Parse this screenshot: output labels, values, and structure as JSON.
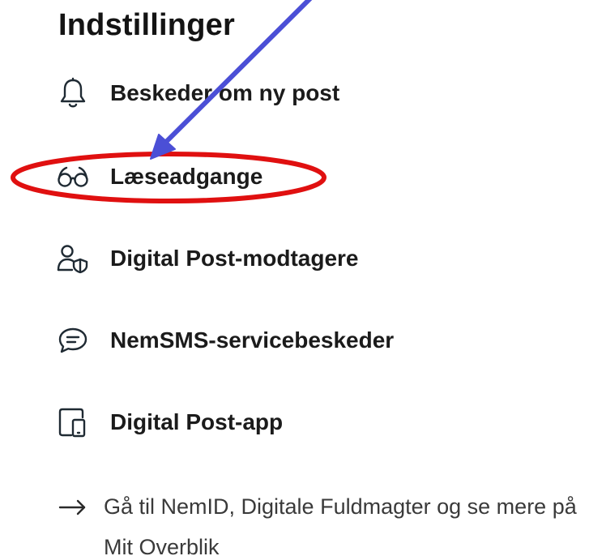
{
  "page": {
    "title": "Indstillinger"
  },
  "settings": {
    "items": [
      {
        "label": "Beskeder om ny post",
        "icon": "bell-icon"
      },
      {
        "label": "Læseadgange",
        "icon": "glasses-icon"
      },
      {
        "label": "Digital Post-modtagere",
        "icon": "user-shield-icon"
      },
      {
        "label": "NemSMS-servicebeskeder",
        "icon": "chat-bubble-icon"
      },
      {
        "label": "Digital Post-app",
        "icon": "tablet-phone-icon"
      }
    ]
  },
  "external_link": {
    "text": "Gå til NemID, Digitale Fuldmagter og se mere på Mit Overblik",
    "icon": "arrow-right-icon"
  },
  "annotation": {
    "arrow_color": "#4b4fd6",
    "ellipse_color": "#e01010",
    "highlighted_item": "Læseadgange"
  },
  "colors": {
    "text": "#1b1b1b",
    "icon_stroke": "#1f2a33",
    "link_text": "#3a3a3a",
    "background": "#ffffff"
  }
}
